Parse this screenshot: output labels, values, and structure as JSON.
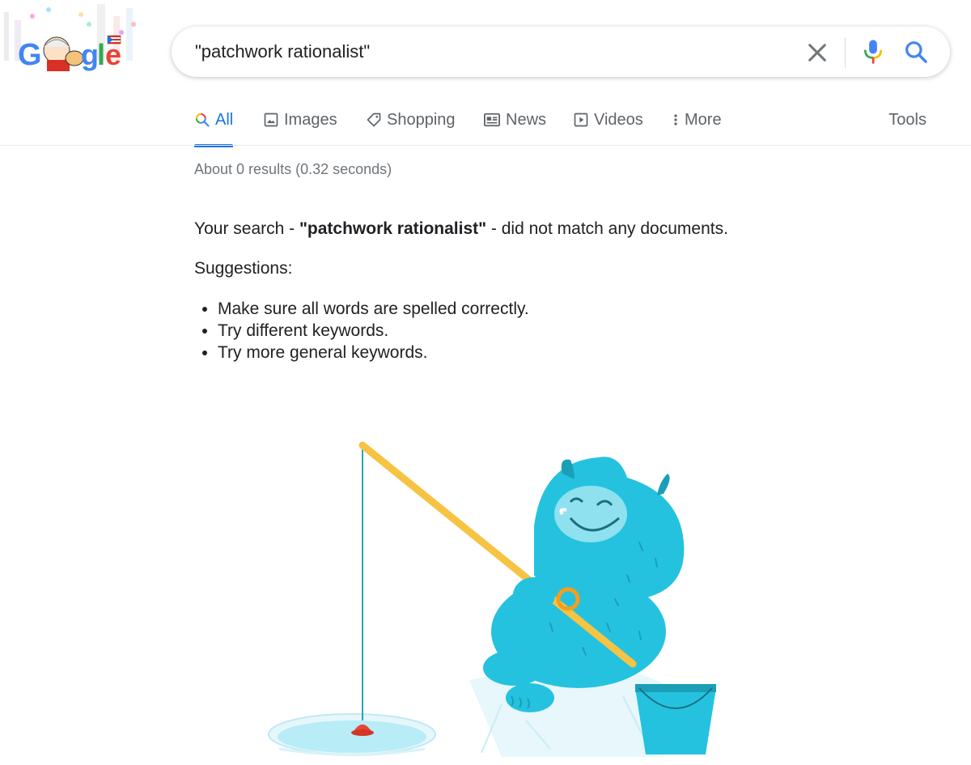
{
  "logo": {
    "text": "Google"
  },
  "search": {
    "query": "\"patchwork rationalist\"",
    "clear_icon": "close-icon",
    "mic_icon": "microphone-icon",
    "search_icon": "search-icon"
  },
  "tabs": [
    {
      "label": "All",
      "icon": "search-multicolor-icon",
      "active": true
    },
    {
      "label": "Images",
      "icon": "image-icon"
    },
    {
      "label": "Shopping",
      "icon": "tag-icon"
    },
    {
      "label": "News",
      "icon": "newspaper-icon"
    },
    {
      "label": "Videos",
      "icon": "play-icon"
    },
    {
      "label": "More",
      "icon": "more-vert-icon"
    }
  ],
  "tools_label": "Tools",
  "result_stats": "About 0 results (0.32 seconds)",
  "no_results": {
    "prefix": "Your search - ",
    "query": "\"patchwork rationalist\"",
    "suffix": " - did not match any documents."
  },
  "suggestions": {
    "title": "Suggestions:",
    "items": [
      "Make sure all words are spelled correctly.",
      "Try different keywords.",
      "Try more general keywords."
    ]
  },
  "colors": {
    "accent": "#1a73e8",
    "text_secondary": "#5f6368",
    "yeti": "#24c1e0",
    "rod": "#f6c343",
    "bobber": "#ea4335"
  }
}
